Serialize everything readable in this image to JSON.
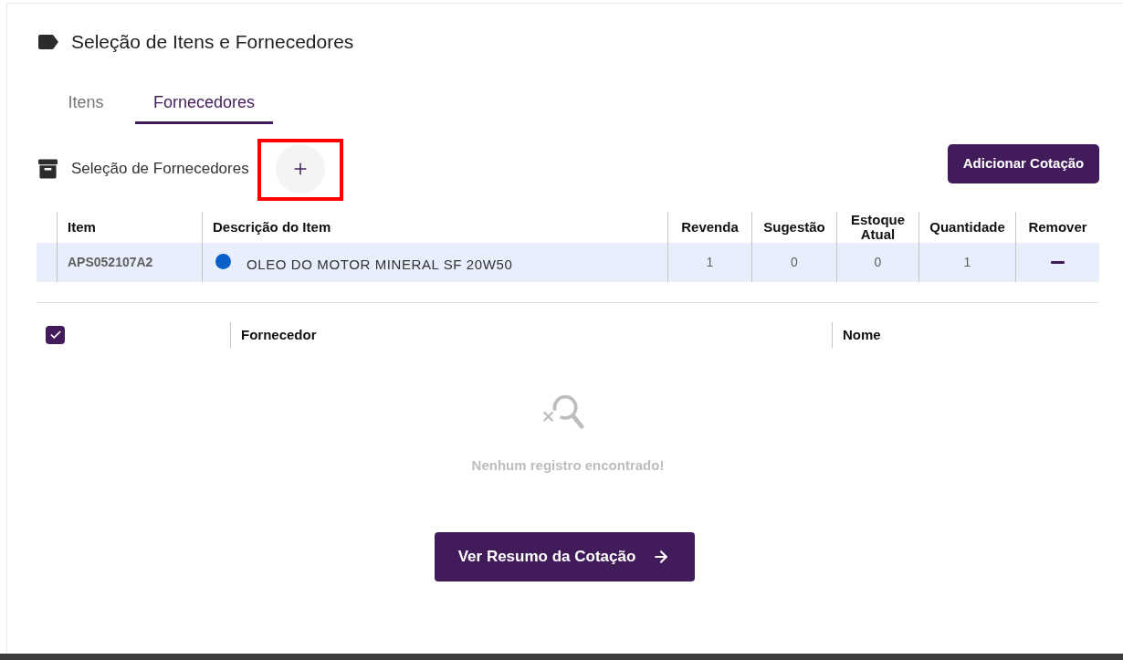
{
  "header": {
    "title": "Seleção de Itens e Fornecedores"
  },
  "tabs": [
    {
      "label": "Itens",
      "selected": false
    },
    {
      "label": "Fornecedores",
      "selected": true
    }
  ],
  "supplier_section": {
    "title": "Seleção de Fornecedores",
    "add_button": {
      "highlighted": true
    },
    "add_quote_button": {
      "label": "Adicionar Cotação"
    }
  },
  "items_table": {
    "columns": [
      "Item",
      "Descrição do Item",
      "Revenda",
      "Sugestão",
      "Estoque Atual",
      "Quantidade",
      "Remover"
    ],
    "rows": [
      {
        "item": "APS052107A2",
        "color": "#0a5fc8",
        "description": "OLEO DO MOTOR MINERAL SF 20W50",
        "revenda": "1",
        "sugestao": "0",
        "estoque_atual": "0",
        "quantidade": "1"
      }
    ]
  },
  "suppliers_table": {
    "select_all": {
      "checked": true
    },
    "columns": [
      "Fornecedor",
      "Nome"
    ],
    "empty_message": "Nenhum registro encontrado!"
  },
  "summary_button": {
    "label": "Ver Resumo da Cotação"
  }
}
